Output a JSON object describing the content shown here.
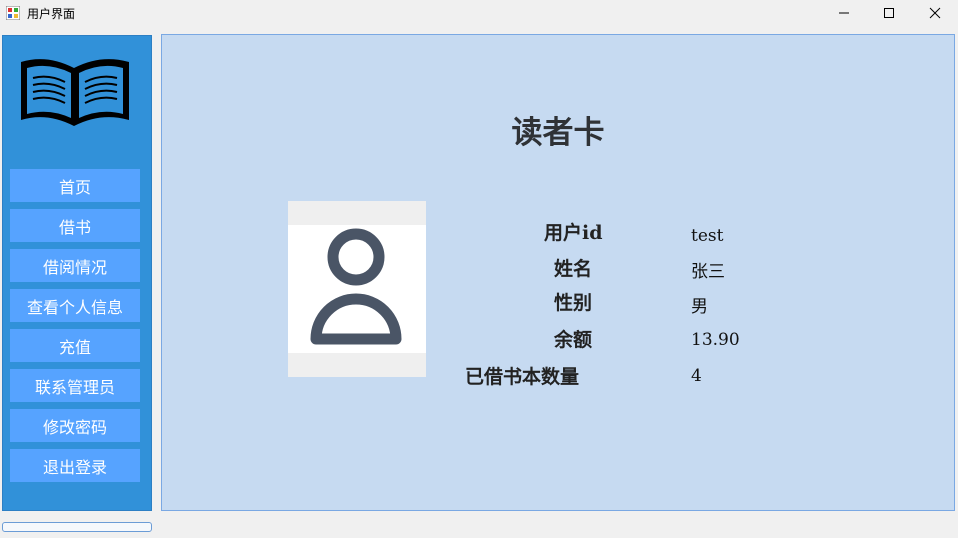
{
  "window": {
    "title": "用户界面"
  },
  "sidebar": {
    "nav_items": [
      "首页",
      "借书",
      "借阅情况",
      "查看个人信息",
      "充值",
      "联系管理员",
      "修改密码",
      "退出登录"
    ]
  },
  "card": {
    "title": "读者卡",
    "fields": [
      {
        "label": "用户id",
        "value": "test"
      },
      {
        "label": "姓名",
        "value": "张三"
      },
      {
        "label": "性别",
        "value": "男"
      },
      {
        "label": "余额",
        "value": "13.90"
      },
      {
        "label": "已借书本数量",
        "value": "4"
      }
    ]
  },
  "colors": {
    "sidebar_bg": "#3191d9",
    "nav_button_bg": "#56a3ff",
    "main_bg": "#c6daf1"
  }
}
